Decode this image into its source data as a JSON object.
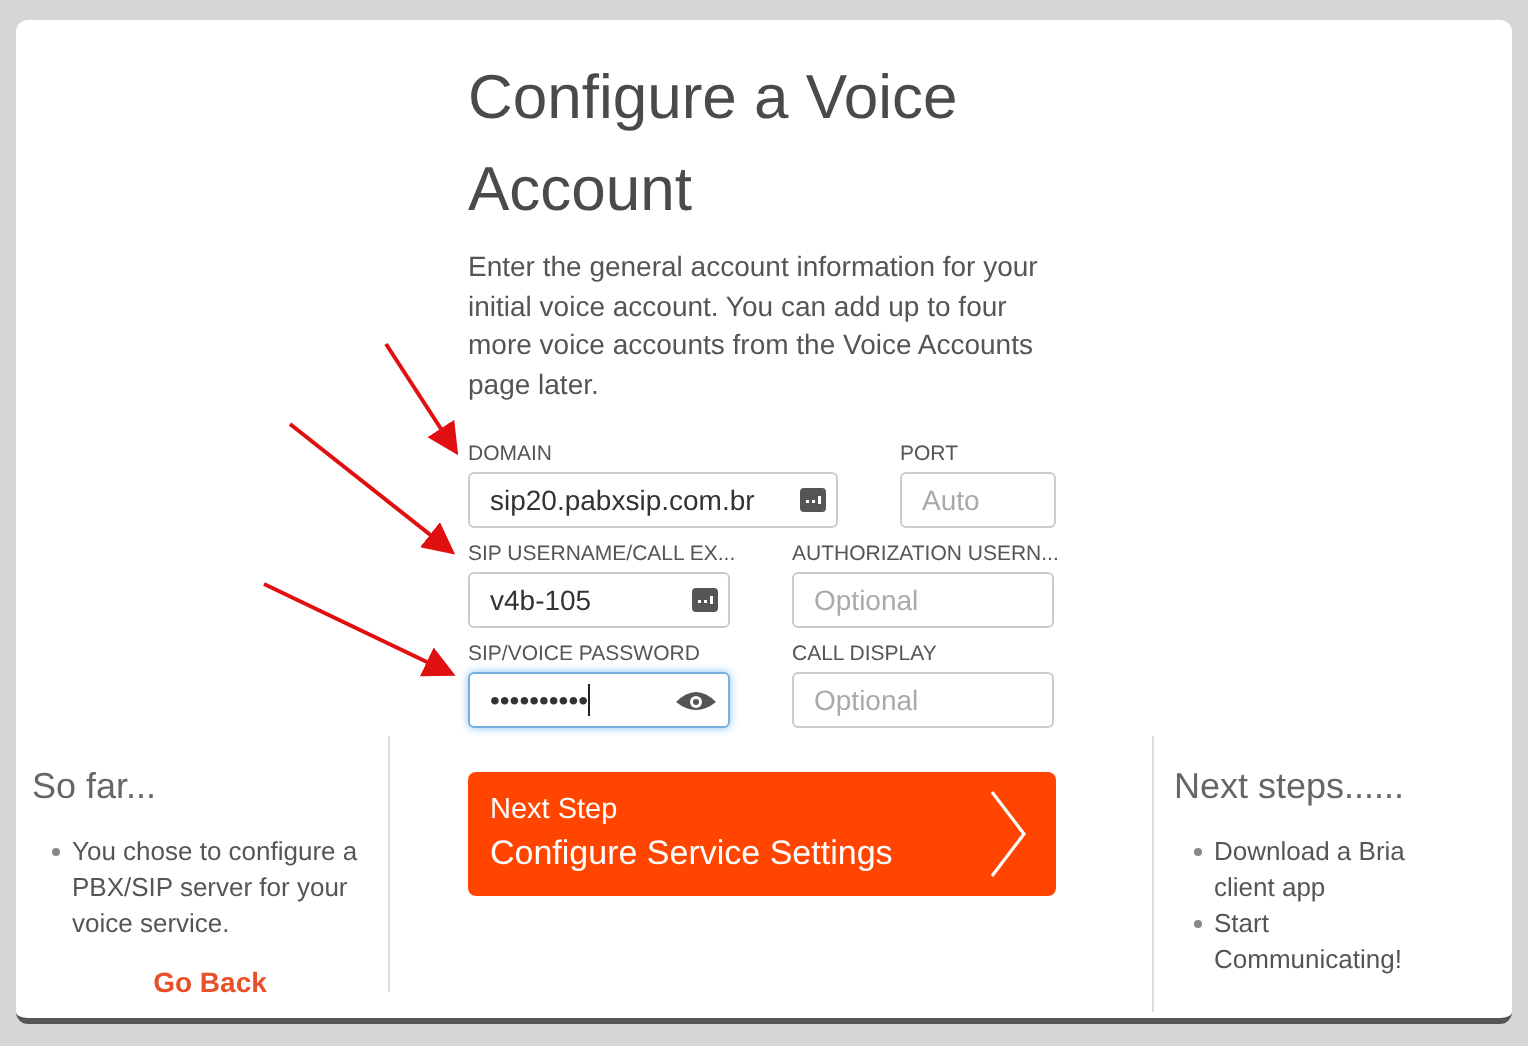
{
  "title": "Configure a Voice Account",
  "intro": "Enter the general account information for your initial voice account. You can add up to four more voice accounts from the Voice Accounts page later.",
  "fields": [
    {
      "label": "DOMAIN",
      "value": "sip20.pabxsip.com.br",
      "kind": "menu",
      "focused": false
    },
    {
      "label": "PORT",
      "placeholder": "Auto",
      "kind": "plain",
      "focused": false
    },
    {
      "label": "SIP USERNAME/CALL EX...",
      "value": "v4b-105",
      "kind": "menu",
      "focused": false
    },
    {
      "label": "AUTHORIZATION USERN...",
      "placeholder": "Optional",
      "kind": "plain",
      "focused": false
    },
    {
      "label": "SIP/VOICE PASSWORD",
      "value": "••••••••••",
      "kind": "password",
      "focused": true
    },
    {
      "label": "CALL DISPLAY",
      "placeholder": "Optional",
      "kind": "plain",
      "focused": false
    }
  ],
  "next_button": {
    "caption": "Next Step",
    "label": "Configure Service Settings"
  },
  "so_far": {
    "title": "So far...",
    "items": [
      "You chose to configure a PBX/SIP server for your voice service."
    ],
    "link": "Go Back"
  },
  "next_steps": {
    "title": "Next steps......",
    "items": [
      "Download a Bria client app",
      "Start Communicating!"
    ]
  }
}
